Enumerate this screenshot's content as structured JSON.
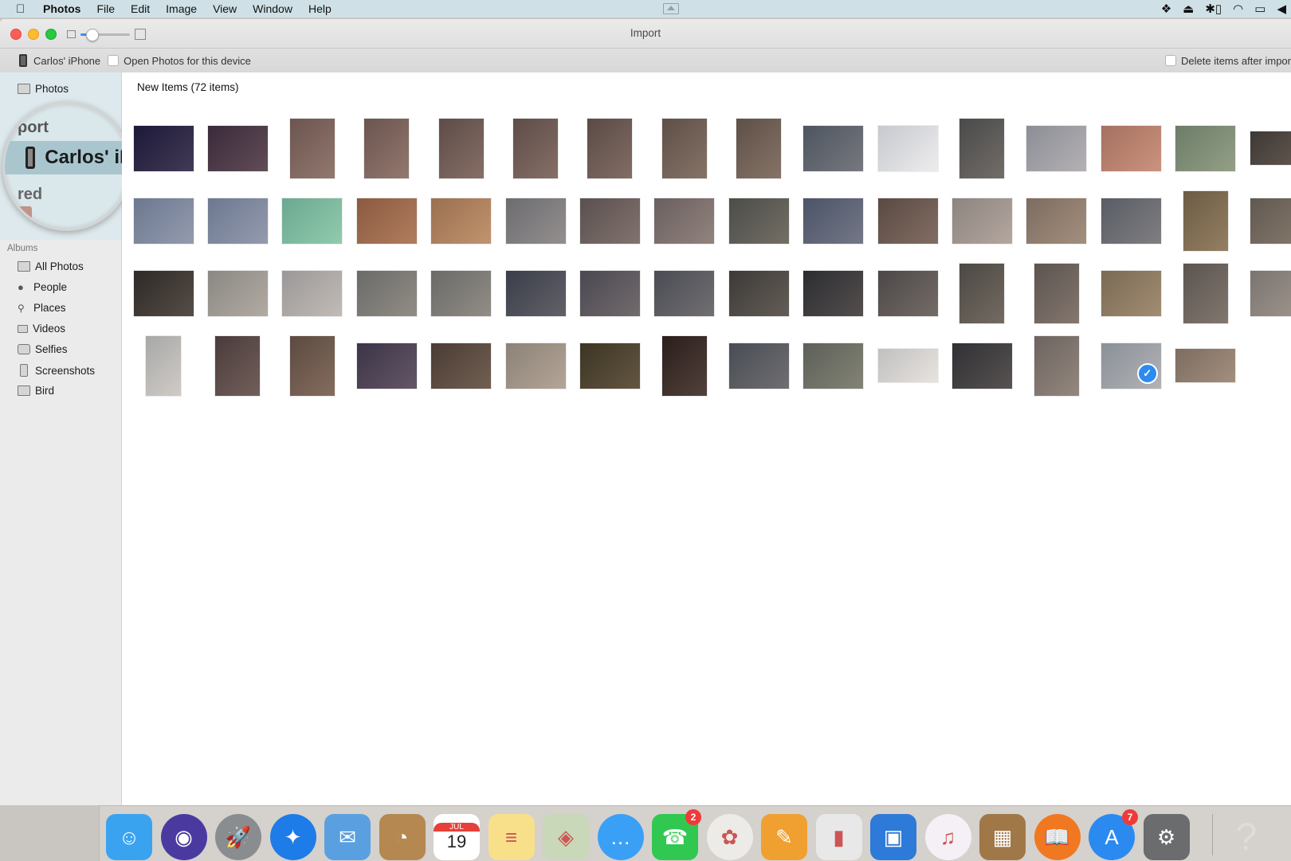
{
  "menubar": {
    "app_name": "Photos",
    "menus": [
      "File",
      "Edit",
      "Image",
      "View",
      "Window",
      "Help"
    ],
    "status_icons": [
      "dropbox-icon",
      "upload-icon",
      "bluetooth-battery-icon",
      "wifi-icon",
      "airplay-icon",
      "volume-icon"
    ]
  },
  "window": {
    "title": "Import",
    "device_name": "Carlos' iPhone",
    "open_photos_label": "Open Photos for this device",
    "open_photos_checked": false,
    "delete_after_import_label": "Delete items after impor",
    "delete_after_import_checked": false,
    "thumbnail_zoom": 0.1
  },
  "sidebar": {
    "library_item": "Photos",
    "import_header": "port",
    "import_device": "Carlos' iP",
    "shared_header": "red",
    "albums_header": "Albums",
    "albums": [
      {
        "label": "All Photos",
        "icon": "album-icon"
      },
      {
        "label": "People",
        "icon": "person-icon"
      },
      {
        "label": "Places",
        "icon": "pin-icon"
      },
      {
        "label": "Videos",
        "icon": "video-icon"
      },
      {
        "label": "Selfies",
        "icon": "selfie-icon"
      },
      {
        "label": "Screenshots",
        "icon": "phone-icon"
      },
      {
        "label": "Bird",
        "icon": "album-icon"
      }
    ]
  },
  "content": {
    "section_title": "New Items (72 items)",
    "rows": [
      [
        {
          "o": "l",
          "c": "#1b1838"
        },
        {
          "o": "l",
          "c": "#3a2a3a"
        },
        {
          "o": "p",
          "c": "#6b5550"
        },
        {
          "o": "p",
          "c": "#6b5550"
        },
        {
          "o": "p",
          "c": "#5e4c48"
        },
        {
          "o": "p",
          "c": "#5e4c48"
        },
        {
          "o": "p",
          "c": "#5a4a46"
        },
        {
          "o": "p",
          "c": "#5e5048"
        },
        {
          "o": "p",
          "c": "#5e5048"
        },
        {
          "o": "l",
          "c": "#4e5560"
        },
        {
          "o": "l",
          "c": "#c6c9cf"
        },
        {
          "o": "p",
          "c": "#4a4a4a"
        },
        {
          "o": "l",
          "c": "#8c8e96"
        },
        {
          "o": "l",
          "c": "#a47060"
        },
        {
          "o": "l",
          "c": "#6c7c68"
        },
        {
          "o": "w",
          "c": "#3e3834"
        }
      ],
      [
        {
          "o": "l",
          "c": "#6c7890"
        },
        {
          "o": "l",
          "c": "#6c7890"
        },
        {
          "o": "l",
          "c": "#6aa890"
        },
        {
          "o": "l",
          "c": "#8a5a40"
        },
        {
          "o": "l",
          "c": "#9a7050"
        },
        {
          "o": "l",
          "c": "#6c6c70"
        },
        {
          "o": "l",
          "c": "#5a5050"
        },
        {
          "o": "l",
          "c": "#6a6060"
        },
        {
          "o": "l",
          "c": "#4c4c48"
        },
        {
          "o": "l",
          "c": "#4c5468"
        },
        {
          "o": "l",
          "c": "#5a4a44"
        },
        {
          "o": "l",
          "c": "#8c8480"
        },
        {
          "o": "l",
          "c": "#7c6c60"
        },
        {
          "o": "l",
          "c": "#585c64"
        },
        {
          "o": "p",
          "c": "#6c5c44"
        },
        {
          "o": "l",
          "c": "#605850"
        }
      ],
      [
        {
          "o": "l",
          "c": "#2e2a28"
        },
        {
          "o": "l",
          "c": "#8a8884"
        },
        {
          "o": "l",
          "c": "#9a9898"
        },
        {
          "o": "l",
          "c": "#6a6a68"
        },
        {
          "o": "l",
          "c": "#6a6a68"
        },
        {
          "o": "l",
          "c": "#3a3e4a"
        },
        {
          "o": "l",
          "c": "#4a4850"
        },
        {
          "o": "l",
          "c": "#4a4c54"
        },
        {
          "o": "l",
          "c": "#3c3a38"
        },
        {
          "o": "l",
          "c": "#2c2c30"
        },
        {
          "o": "l",
          "c": "#4c4848"
        },
        {
          "o": "p",
          "c": "#4c4844"
        },
        {
          "o": "p",
          "c": "#5c5450"
        },
        {
          "o": "l",
          "c": "#7a6a54"
        },
        {
          "o": "p",
          "c": "#5a5450"
        },
        {
          "o": "l",
          "c": "#7a7470"
        }
      ],
      [
        {
          "o": "pn",
          "c": "#a8a8a8"
        },
        {
          "o": "p",
          "c": "#4a3c3c"
        },
        {
          "o": "p",
          "c": "#5c4a40"
        },
        {
          "o": "l",
          "c": "#3c3448"
        },
        {
          "o": "l",
          "c": "#4a3c34"
        },
        {
          "o": "l",
          "c": "#8c8278"
        },
        {
          "o": "l",
          "c": "#3c3424"
        },
        {
          "o": "p",
          "c": "#2a1e1c"
        },
        {
          "o": "l",
          "c": "#484c54"
        },
        {
          "o": "l",
          "c": "#5c6058"
        },
        {
          "o": "w",
          "c": "#c0c0c0"
        },
        {
          "o": "l",
          "c": "#303034"
        },
        {
          "o": "p",
          "c": "#6c6460"
        },
        {
          "o": "l",
          "c": "#8a9098",
          "selected": true
        },
        {
          "o": "w",
          "c": "#7c6c60"
        }
      ]
    ]
  },
  "dock": {
    "apps": [
      {
        "name": "Finder",
        "color": "#3aa3f0",
        "glyph": "☺"
      },
      {
        "name": "Siri",
        "color": "#4a3aa0",
        "glyph": "◉"
      },
      {
        "name": "Launchpad",
        "color": "#8a8d90",
        "glyph": "🚀"
      },
      {
        "name": "Safari",
        "color": "#1d7ce8",
        "glyph": "✦"
      },
      {
        "name": "Mail",
        "color": "#5aa0e0",
        "glyph": "✉"
      },
      {
        "name": "Contacts",
        "color": "#b48850",
        "glyph": "◔"
      },
      {
        "name": "Calendar",
        "color": "#ffffff",
        "glyph": "19",
        "top_label": "JUL"
      },
      {
        "name": "Notes",
        "color": "#f8e08a",
        "glyph": "≡"
      },
      {
        "name": "Maps",
        "color": "#c8d8b8",
        "glyph": "◈"
      },
      {
        "name": "Messages",
        "color": "#3aa0f5",
        "glyph": "…"
      },
      {
        "name": "FaceTime",
        "color": "#30c850",
        "glyph": "☎",
        "badge": "2"
      },
      {
        "name": "Photos",
        "color": "#ecebe8",
        "glyph": "✿"
      },
      {
        "name": "Pages",
        "color": "#f0a030",
        "glyph": "✎"
      },
      {
        "name": "Numbers",
        "color": "#e8e8e8",
        "glyph": "▮"
      },
      {
        "name": "Keynote",
        "color": "#2e7ad8",
        "glyph": "▣"
      },
      {
        "name": "iTunes",
        "color": "#f5f0f5",
        "glyph": "♫"
      },
      {
        "name": "iPhoto",
        "color": "#a07848",
        "glyph": "▦"
      },
      {
        "name": "iBooks",
        "color": "#f07820",
        "glyph": "📖"
      },
      {
        "name": "App Store",
        "color": "#2a8af0",
        "glyph": "A",
        "badge": "7"
      },
      {
        "name": "System Preferences",
        "color": "#6a6c6e",
        "glyph": "⚙"
      },
      {
        "name": "Help",
        "color": "transparent",
        "glyph": "?"
      }
    ]
  }
}
